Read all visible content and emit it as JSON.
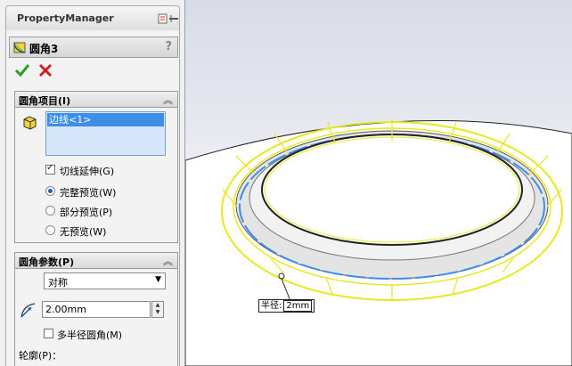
{
  "property_manager": {
    "title": "PropertyManager",
    "feature_name": "圆角3",
    "help": "?",
    "fillet_items": {
      "header": "圆角项目(I)",
      "selected_edge": "边线<1>",
      "tangent_propagation": {
        "label": "切线延伸(G)",
        "checked": true
      },
      "preview_options": [
        {
          "label": "完整预览(W)",
          "selected": true
        },
        {
          "label": "部分预览(P)",
          "selected": false
        },
        {
          "label": "无预览(W)",
          "selected": false
        }
      ]
    },
    "fillet_parameters": {
      "header": "圆角参数(P)",
      "method": "对称",
      "radius": "2.00mm",
      "multi_radius": {
        "label": "多半径圆角(M)",
        "checked": false
      },
      "profile_label": "轮廓(P)："
    }
  },
  "viewport": {
    "dimension_callout": {
      "label": "半径:",
      "value": "2mm"
    }
  },
  "colors": {
    "selection": "#3d8ee6",
    "preview": "#e8e820",
    "accept": "#2a9d2a",
    "cancel": "#d02020"
  }
}
